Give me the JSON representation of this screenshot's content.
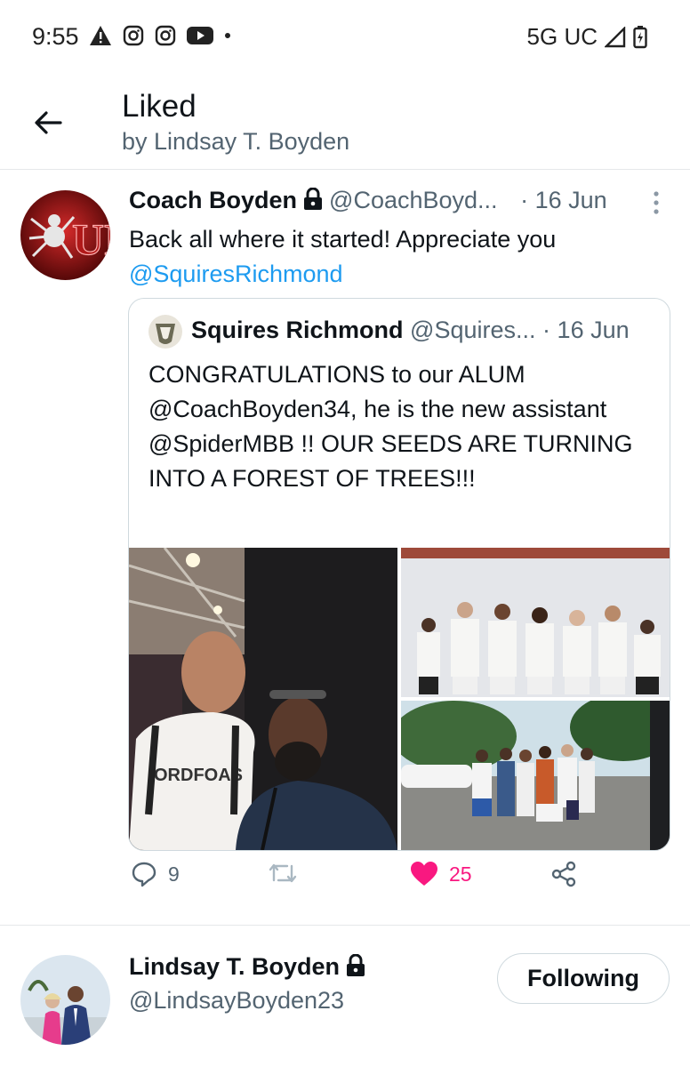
{
  "status_bar": {
    "time": "9:55",
    "network": "5G UC"
  },
  "header": {
    "title": "Liked",
    "subtitle": "by Lindsay T. Boyden"
  },
  "tweet": {
    "author_name": "Coach Boyden",
    "author_handle": "@CoachBoyd...",
    "dot": "·",
    "time": "16 Jun",
    "text": "Back all where it started! Appreciate you",
    "mention": "@SquiresRichmond",
    "quoted": {
      "author_name": "Squires Richmond",
      "author_handle": "@Squires...",
      "dot": "·",
      "time": "16 Jun",
      "text": "CONGRATULATIONS to our ALUM @CoachBoyden34, he is the new assistant @SpiderMBB !! OUR SEEDS ARE TURNING INTO A FOREST OF TREES!!!"
    },
    "actions": {
      "replies": "9",
      "retweets": "",
      "likes": "25"
    },
    "colors": {
      "like": "#f91880",
      "mention": "#1d9bf0"
    }
  },
  "profile": {
    "name": "Lindsay T. Boyden",
    "handle": "@LindsayBoyden23",
    "follow_label": "Following"
  }
}
